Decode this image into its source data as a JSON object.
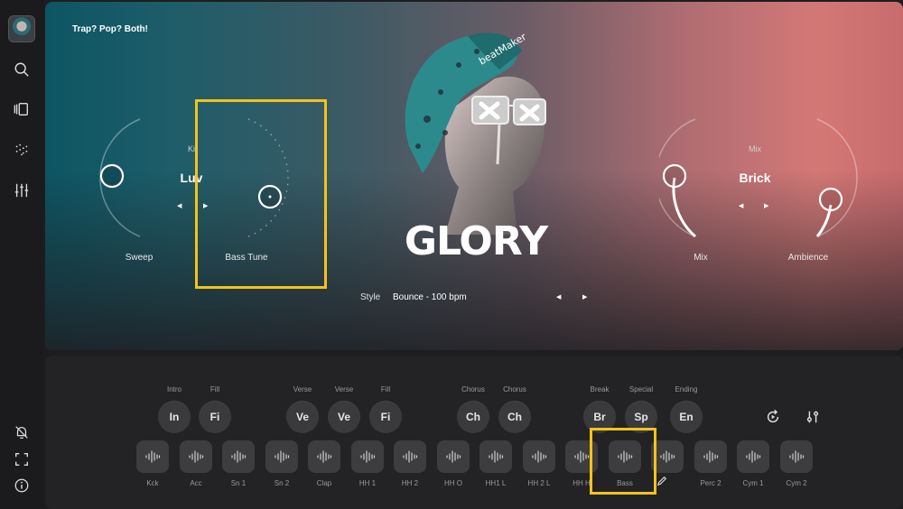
{
  "sidebar": {
    "avatar": "app-avatar",
    "top_icons": [
      "search-icon",
      "library-icon",
      "sequencer-icon",
      "mixer-icon"
    ],
    "bottom_icons": [
      "notifications-off-icon",
      "fullscreen-icon",
      "info-icon"
    ]
  },
  "hero": {
    "tagline": "Trap? Pop? Both!",
    "left_preset": {
      "small_label": "Ki",
      "name": "Luv"
    },
    "right_preset": {
      "small_label": "Mix",
      "name": "Brick"
    },
    "knobs": {
      "sweep": "Sweep",
      "bass_tune": "Bass Tune",
      "mix": "Mix",
      "ambience": "Ambience"
    },
    "statue_text": "beatMaker",
    "title": "GLORY",
    "style_label": "Style",
    "style_value": "Bounce - 100 bpm"
  },
  "parts": [
    {
      "section": "Intro",
      "label": "In"
    },
    {
      "section": "Fill",
      "label": "Fi"
    },
    {
      "section": "Verse",
      "label": "Ve"
    },
    {
      "section": "Verse",
      "label": "Ve"
    },
    {
      "section": "Fill",
      "label": "Fi"
    },
    {
      "section": "Chorus",
      "label": "Ch"
    },
    {
      "section": "Chorus",
      "label": "Ch"
    },
    {
      "section": "Break",
      "label": "Br"
    },
    {
      "section": "Special",
      "label": "Sp"
    },
    {
      "section": "Ending",
      "label": "En"
    }
  ],
  "pads": [
    "Kck",
    "Acc",
    "Sn 1",
    "Sn 2",
    "Clap",
    "HH 1",
    "HH 2",
    "HH O",
    "HH1 L",
    "HH 2 L",
    "HH H",
    "Bass",
    "",
    "Perc 2",
    "Cym 1",
    "Cym 2"
  ],
  "tools": [
    "replay-icon",
    "settings-sliders-icon",
    "pencil-icon"
  ]
}
